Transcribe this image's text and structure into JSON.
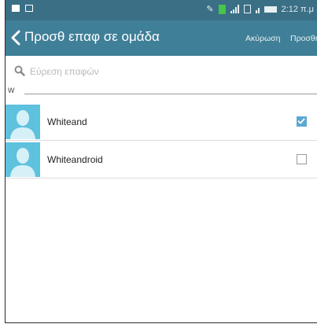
{
  "status_bar": {
    "time": "2:12 π.μ"
  },
  "app_bar": {
    "title": "Προσθ επαφ σε ομάδα",
    "cancel_label": "Ακύρωση",
    "add_label": "Προσθήκη"
  },
  "search": {
    "placeholder": "Εύρεση επαφών"
  },
  "section": {
    "letter": "W"
  },
  "contacts": [
    {
      "name": "Whiteand",
      "checked": true
    },
    {
      "name": "Whiteandroid",
      "checked": false
    }
  ],
  "colors": {
    "status_bar": "#3a6f86",
    "app_bar": "#3f7f97",
    "avatar": "#5ec1de",
    "checkbox_checked": "#5aa9d3"
  },
  "icons": [
    "notification-icon",
    "screenshot-icon",
    "mute-icon",
    "battery-saver-icon",
    "signal-icon",
    "sim-icon",
    "battery-icon",
    "back-arrow-icon",
    "search-icon",
    "person-placeholder-icon",
    "checkmark-icon"
  ]
}
